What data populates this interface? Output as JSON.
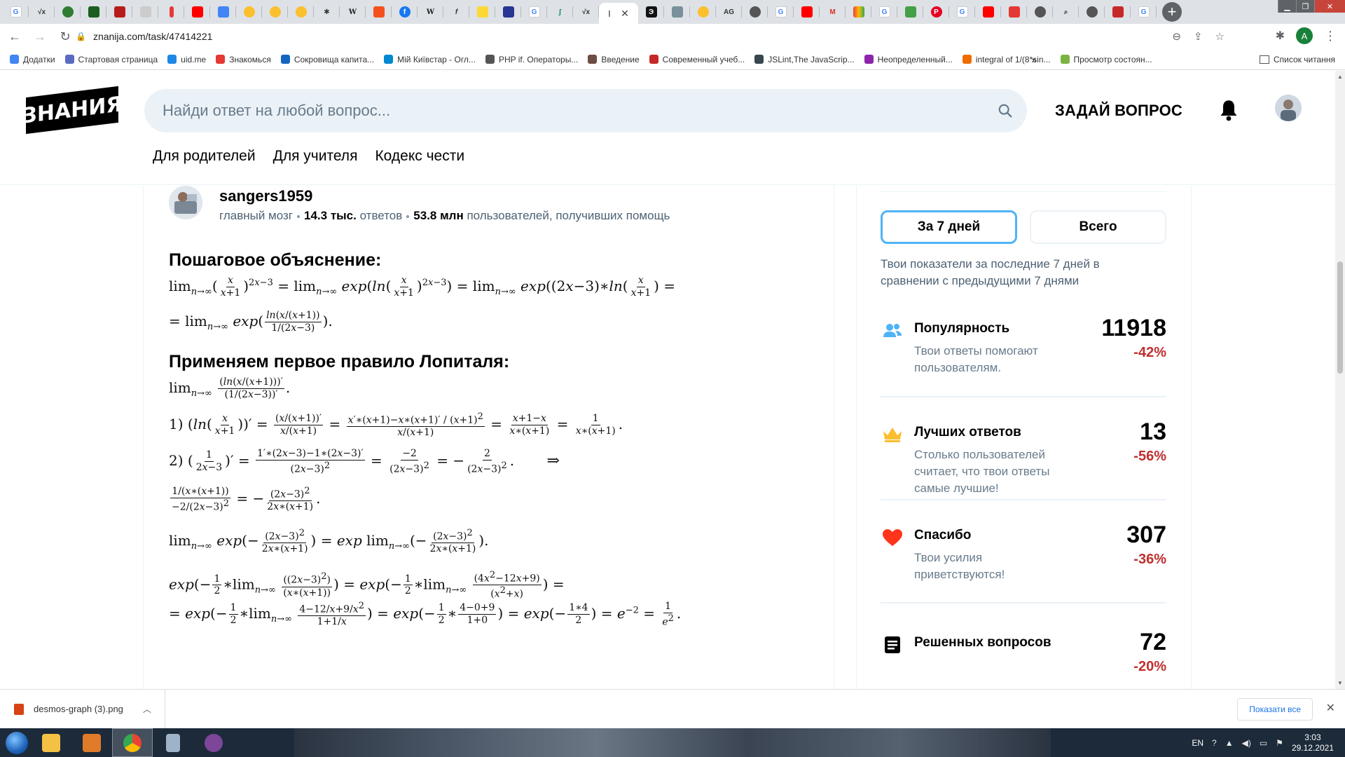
{
  "browser": {
    "active_tab_label": "I",
    "tab_close": "✕",
    "new_tab": "+",
    "url": "znanija.com/task/47414221",
    "profile_initial": "A",
    "bookmarks": [
      {
        "label": "Додатки",
        "color": "#4285f4"
      },
      {
        "label": "Стартовая страница",
        "color": "#5c6bc0"
      },
      {
        "label": "uid.me",
        "color": "#1e88e5"
      },
      {
        "label": "Знакомься",
        "color": "#e53935"
      },
      {
        "label": "Сокровища капита...",
        "color": "#1565c0"
      },
      {
        "label": "Мій Київстар - Огл...",
        "color": "#0288d1"
      },
      {
        "label": "PHP if. Операторы...",
        "color": "#555555"
      },
      {
        "label": "Введение",
        "color": "#6d4c41"
      },
      {
        "label": "Современный учеб...",
        "color": "#c62828"
      },
      {
        "label": "JSLint,The JavaScrip...",
        "color": "#37474f"
      },
      {
        "label": "Неопределенный...",
        "color": "#8e24aa"
      },
      {
        "label": "integral of 1/(8*sin...",
        "color": "#ef6c00"
      },
      {
        "label": "Просмотр состоян...",
        "color": "#7cb342"
      }
    ],
    "bookmarks_more": "»",
    "reading_list": "Список читання"
  },
  "site": {
    "logo_text": "ЗНАНИЯ",
    "search_placeholder": "Найди ответ на любой вопрос...",
    "ask_button": "ЗАДАЙ ВОПРОС",
    "nav": [
      "Для родителей",
      "Для учителя",
      "Кодекс чести"
    ]
  },
  "answer": {
    "author_name": "sangers1959",
    "author_rank": "главный мозг",
    "answers_count": "14.3 тыс.",
    "answers_word": "ответов",
    "helped_count": "53.8 млн",
    "helped_text": "пользователей, получивших помощь",
    "heading_explanation": "Пошаговое объяснение:",
    "heading_lhopital": "Применяем первое правило Лопиталя:"
  },
  "stats": {
    "tabs": [
      "За 7 дней",
      "Всего"
    ],
    "active_tab": 0,
    "description": "Твои показатели за последние 7 дней в сравнении с предыдущими 7 днями",
    "items": [
      {
        "label": "Популярность",
        "value": "11918",
        "desc": "Твои ответы помогают пользователям.",
        "change": "-42%",
        "icon": "users-icon",
        "color": "#4fb3f6"
      },
      {
        "label": "Лучших ответов",
        "value": "13",
        "desc": "Столько пользователей считает, что твои ответы самые лучшие!",
        "change": "-56%",
        "icon": "crown-icon",
        "color": "#fbbe2e"
      },
      {
        "label": "Спасибо",
        "value": "307",
        "desc": "Твои усилия приветствуются!",
        "change": "-36%",
        "icon": "heart-icon",
        "color": "#ff341a"
      },
      {
        "label": "Решенных вопросов",
        "value": "72",
        "desc": "",
        "change": "-20%",
        "icon": "list-icon",
        "color": "#000000"
      }
    ]
  },
  "downloads": {
    "file_name": "desmos-graph (3).png",
    "show_all": "Показати все"
  },
  "taskbar": {
    "lang": "EN",
    "time": "3:03",
    "date": "29.12.2021"
  }
}
